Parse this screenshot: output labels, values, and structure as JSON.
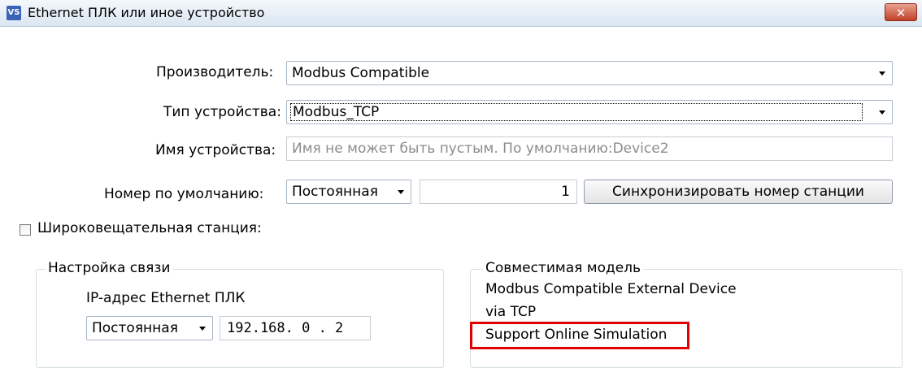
{
  "window": {
    "icon_text": "VS",
    "title": "Ethernet ПЛК или иное устройство",
    "close_label": "✕"
  },
  "form": {
    "manufacturer_label": "Производитель:",
    "manufacturer_value": "Modbus Compatible",
    "device_type_label": "Тип устройства:",
    "device_type_value": "Modbus_TCP",
    "device_name_label": "Имя устройства:",
    "device_name_placeholder": "Имя не может быть пустым. По умолчанию:Device2",
    "default_number_label": "Номер по умолчанию:",
    "default_number_mode": "Постоянная",
    "default_number_value": "1",
    "sync_button_label": "Синхронизировать номер станции",
    "broadcast_label": "Широковещательная станция:",
    "broadcast_checked": false
  },
  "connection": {
    "group_title": "Настройка связи",
    "ip_label": "IP-адрес Ethernet ПЛК",
    "ip_mode": "Постоянная",
    "ip_value": "192.168. 0 . 2"
  },
  "compatible": {
    "group_title": "Совместимая модель",
    "line1": "Modbus Compatible External Device",
    "line2": "via TCP",
    "line3": "Support Online Simulation",
    "highlight_color": "#e00000"
  }
}
